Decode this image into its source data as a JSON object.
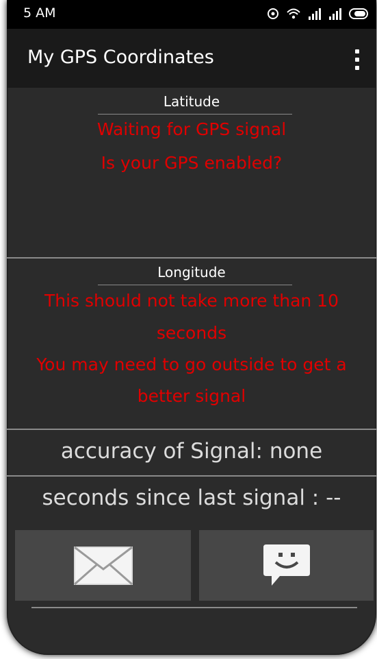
{
  "status_bar": {
    "time": "5 AM",
    "icons": [
      "location-icon",
      "wifi-icon",
      "signal-icon",
      "signal-icon",
      "battery-icon"
    ]
  },
  "action_bar": {
    "title": "My GPS Coordinates",
    "menu_icon": "overflow-menu-icon"
  },
  "latitude": {
    "label": "Latitude",
    "lines": [
      "Waiting for GPS signal",
      "Is your GPS enabled?"
    ]
  },
  "longitude": {
    "label": "Longitude",
    "lines": [
      "This should not take more than 10",
      "seconds",
      "You may need to go outside to get a",
      "better signal"
    ]
  },
  "accuracy": {
    "text": "accuracy of Signal: none"
  },
  "last_signal": {
    "text": "seconds since last signal : --"
  },
  "buttons": [
    {
      "icon": "email-icon"
    },
    {
      "icon": "sms-icon"
    }
  ],
  "colors": {
    "background": "#2b2b2b",
    "warning_text": "#e00000",
    "button": "#474747"
  }
}
